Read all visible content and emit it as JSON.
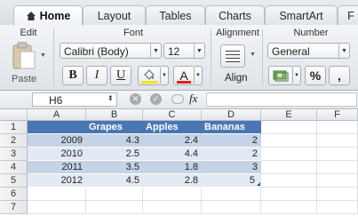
{
  "tabs": [
    {
      "label": "Home",
      "active": true
    },
    {
      "label": "Layout"
    },
    {
      "label": "Tables"
    },
    {
      "label": "Charts"
    },
    {
      "label": "SmartArt"
    },
    {
      "label": "F"
    }
  ],
  "ribbon": {
    "edit_group": "Edit",
    "paste_label": "Paste",
    "font_group": "Font",
    "font_name": "Calibri (Body)",
    "font_size": "12",
    "bold": "B",
    "italic": "I",
    "underline": "U",
    "font_color_letter": "A",
    "alignment_group": "Alignment",
    "align_label": "Align",
    "number_group": "Number",
    "number_format": "General",
    "percent": "%",
    "comma": ","
  },
  "formula_bar": {
    "name_box": "H6",
    "fx": "fx",
    "formula": ""
  },
  "columns": [
    "A",
    "B",
    "C",
    "D",
    "E",
    "F"
  ],
  "rows": [
    "1",
    "2",
    "3",
    "4",
    "5",
    "6",
    "7"
  ],
  "table": {
    "headers": [
      "",
      "Grapes",
      "Apples",
      "Bananas"
    ],
    "rows": [
      [
        "2009",
        "4.3",
        "2.4",
        "2"
      ],
      [
        "2010",
        "2.5",
        "4.4",
        "2"
      ],
      [
        "2011",
        "3.5",
        "1.8",
        "3"
      ],
      [
        "2012",
        "4.5",
        "2.8",
        "5"
      ]
    ]
  },
  "colors": {
    "table_header": "#4a77b4",
    "band_dark": "#c5d3e7",
    "band_light": "#e2e9f3",
    "highlight_yellow": "#f5e500",
    "font_red": "#e0201c"
  }
}
